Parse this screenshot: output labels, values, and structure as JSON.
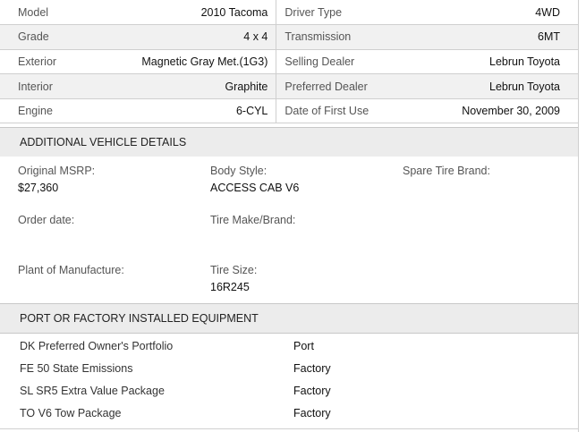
{
  "specs": [
    {
      "label": "Model",
      "value": "2010 Tacoma",
      "label2": "Driver Type",
      "value2": "4WD"
    },
    {
      "label": "Grade",
      "value": "4 x 4",
      "label2": "Transmission",
      "value2": "6MT"
    },
    {
      "label": "Exterior",
      "value": "Magnetic Gray Met.(1G3)",
      "label2": "Selling Dealer",
      "value2": "Lebrun Toyota"
    },
    {
      "label": "Interior",
      "value": "Graphite",
      "label2": "Preferred Dealer",
      "value2": "Lebrun Toyota"
    },
    {
      "label": "Engine",
      "value": "6-CYL",
      "label2": "Date of First Use",
      "value2": "November 30, 2009"
    }
  ],
  "additional": {
    "header": "ADDITIONAL VEHICLE DETAILS",
    "original_msrp": {
      "label": "Original MSRP:",
      "value": "$27,360"
    },
    "body_style": {
      "label": "Body Style:",
      "value": "ACCESS CAB V6"
    },
    "spare_tire": {
      "label": "Spare Tire Brand:",
      "value": ""
    },
    "order_date": {
      "label": "Order date:",
      "value": ""
    },
    "tire_make": {
      "label": "Tire Make/Brand:",
      "value": ""
    },
    "plant": {
      "label": "Plant of Manufacture:",
      "value": ""
    },
    "tire_size": {
      "label": "Tire Size:",
      "value": "16R245"
    }
  },
  "equipment": {
    "header": "PORT OR FACTORY INSTALLED EQUIPMENT",
    "items": [
      {
        "name": "DK Preferred Owner's Portfolio",
        "type": "Port"
      },
      {
        "name": "FE 50 State Emissions",
        "type": "Factory"
      },
      {
        "name": "SL SR5 Extra Value Package",
        "type": "Factory"
      },
      {
        "name": "TO V6 Tow Package",
        "type": "Factory"
      }
    ]
  }
}
